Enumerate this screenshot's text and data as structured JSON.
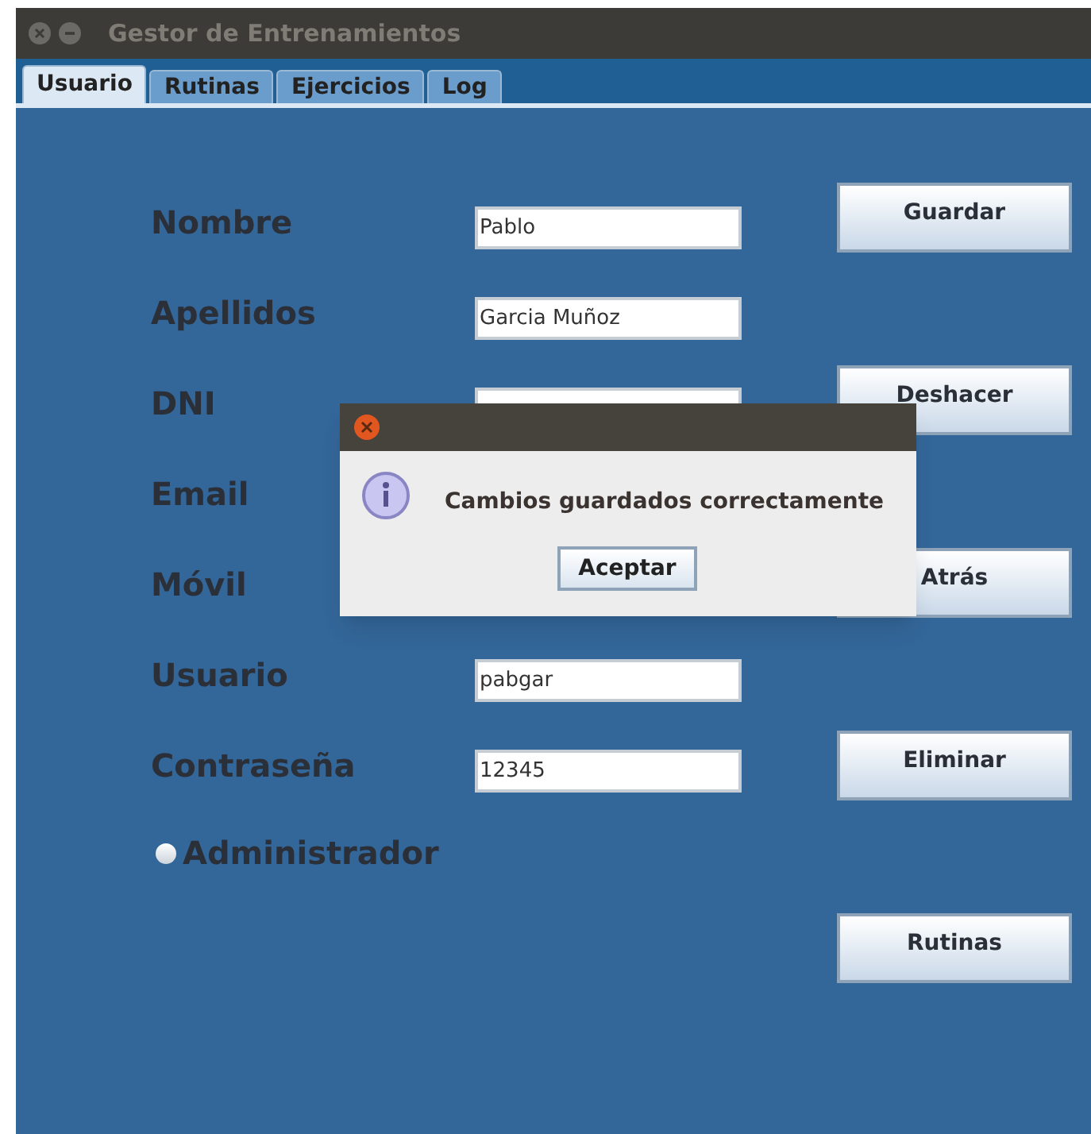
{
  "window": {
    "title": "Gestor de Entrenamientos"
  },
  "tabs": [
    {
      "label": "Usuario",
      "selected": true
    },
    {
      "label": "Rutinas",
      "selected": false
    },
    {
      "label": "Ejercicios",
      "selected": false
    },
    {
      "label": "Log",
      "selected": false
    }
  ],
  "form": [
    {
      "label": "Nombre",
      "value": "Pablo"
    },
    {
      "label": "Apellidos",
      "value": "Garcia Muñoz"
    },
    {
      "label": "DNI"
    },
    {
      "label": "Email"
    },
    {
      "label": "Móvil"
    },
    {
      "label": "Usuario",
      "value": "pabgar"
    },
    {
      "label": "Contraseña",
      "value": "12345"
    }
  ],
  "admin": {
    "label": "Administrador",
    "checked": false
  },
  "buttons": [
    "Guardar",
    "Deshacer",
    "Atrás",
    "Eliminar",
    "Rutinas"
  ],
  "dialog": {
    "message": "Cambios guardados correctamente",
    "button": "Aceptar"
  }
}
